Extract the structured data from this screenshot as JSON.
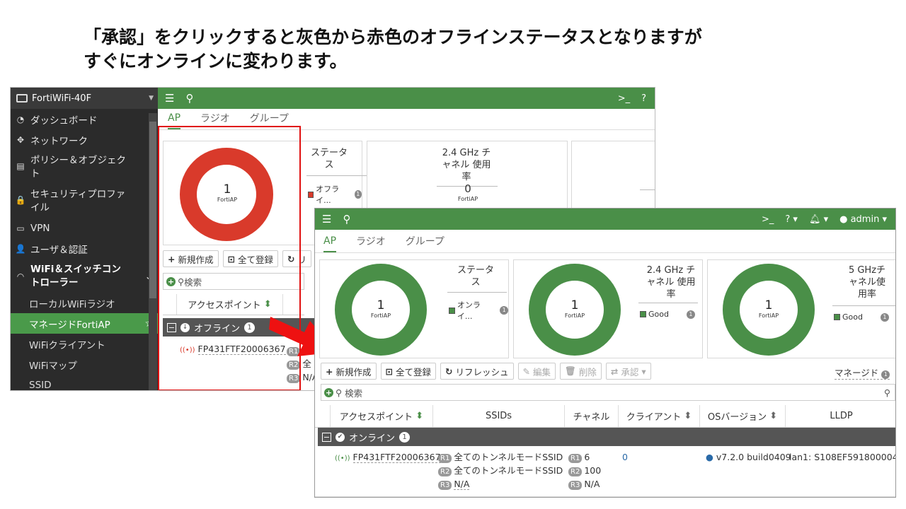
{
  "caption": {
    "line1": "「承認」をクリックすると灰色から赤色のオフラインステータスとなりますが",
    "line2": "すぐにオンラインに変わります。"
  },
  "colors": {
    "green": "#4a8f48",
    "red": "#d93a2b",
    "sidebar": "#2b2b2b",
    "highlight": "#e01010"
  },
  "back": {
    "device": "FortiWiFi-40F",
    "sidebar": [
      {
        "label": "ダッシュボード",
        "icon": "dashboard-icon"
      },
      {
        "label": "ネットワーク",
        "icon": "network-icon"
      },
      {
        "label": "ポリシー＆オブジェクト",
        "icon": "policy-icon"
      },
      {
        "label": "セキュリティプロファイル",
        "icon": "lock-icon"
      },
      {
        "label": "VPN",
        "icon": "monitor-icon"
      },
      {
        "label": "ユーザ＆認証",
        "icon": "user-icon"
      },
      {
        "label": "WiFi＆スイッチコントローラー",
        "icon": "wifi-icon"
      }
    ],
    "subitems": [
      "ローカルWiFiラジオ",
      "マネージドFortiAP",
      "WiFiクライアント",
      "WiFiマップ",
      "SSID"
    ],
    "tabs": [
      "AP",
      "ラジオ",
      "グループ"
    ],
    "donut": {
      "count": "1",
      "label": "FortiAP",
      "status": "offline"
    },
    "status_title": "ステータス",
    "status_legend": "オフライ...",
    "status_count": "1",
    "channel_title": "2.4 GHz チャネル 使用率",
    "channel_value": "0",
    "channel_label": "FortiAP",
    "buttons": {
      "new": "新規作成",
      "register": "全て登録",
      "refresh": "リ"
    },
    "search_placeholder": "検索",
    "col_ap": "アクセスポイント",
    "group_label": "オフライン",
    "group_count": "1",
    "ap_name": "FP431FTF20006367",
    "r_tags": [
      "R1",
      "R2",
      "R3"
    ],
    "r_vals": [
      "全",
      "全",
      "N/A"
    ]
  },
  "front": {
    "tabs": [
      "AP",
      "ラジオ",
      "グループ"
    ],
    "user": "admin",
    "cards": [
      {
        "count": "1",
        "label": "FortiAP",
        "title": "ステータス",
        "legend": "オンライ...",
        "legend_count": "1"
      },
      {
        "count": "1",
        "label": "FortiAP",
        "title": "2.4 GHz チャネル 使用率",
        "legend": "Good",
        "legend_count": "1"
      },
      {
        "count": "1",
        "label": "FortiAP",
        "title": "5 GHzチャネル使用率",
        "legend": "Good",
        "legend_count": "1"
      }
    ],
    "buttons": {
      "new": "新規作成",
      "register": "全て登録",
      "refresh": "リフレッシュ",
      "edit": "編集",
      "delete": "削除",
      "approve": "承認"
    },
    "view_label": "マネージド",
    "view_count": "1",
    "search_placeholder": "検索",
    "columns": [
      "アクセスポイント",
      "SSIDs",
      "チャネル",
      "クライアント",
      "OSバージョン",
      "LLDP"
    ],
    "group_label": "オンライン",
    "group_count": "1",
    "row": {
      "ap": "FP431FTF20006367",
      "ssids": [
        "全てのトンネルモードSSID",
        "全てのトンネルモードSSID",
        "N/A"
      ],
      "channels": [
        "6",
        "100",
        "N/A"
      ],
      "clients": "0",
      "os": "v7.2.0 build0409",
      "lldp": "lan1: S108EF5918000047 -"
    }
  }
}
